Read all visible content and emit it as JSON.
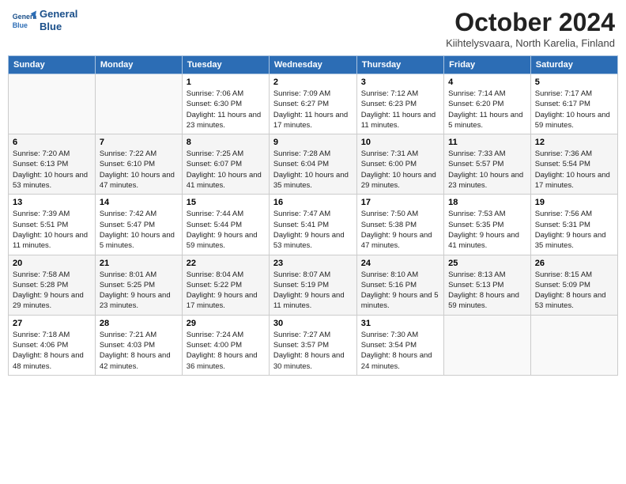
{
  "header": {
    "logo_line1": "General",
    "logo_line2": "Blue",
    "month_title": "October 2024",
    "location": "Kiihtelysvaara, North Karelia, Finland"
  },
  "days_of_week": [
    "Sunday",
    "Monday",
    "Tuesday",
    "Wednesday",
    "Thursday",
    "Friday",
    "Saturday"
  ],
  "weeks": [
    [
      {
        "day": null,
        "info": ""
      },
      {
        "day": null,
        "info": ""
      },
      {
        "day": "1",
        "info": "Sunrise: 7:06 AM\nSunset: 6:30 PM\nDaylight: 11 hours and 23 minutes."
      },
      {
        "day": "2",
        "info": "Sunrise: 7:09 AM\nSunset: 6:27 PM\nDaylight: 11 hours and 17 minutes."
      },
      {
        "day": "3",
        "info": "Sunrise: 7:12 AM\nSunset: 6:23 PM\nDaylight: 11 hours and 11 minutes."
      },
      {
        "day": "4",
        "info": "Sunrise: 7:14 AM\nSunset: 6:20 PM\nDaylight: 11 hours and 5 minutes."
      },
      {
        "day": "5",
        "info": "Sunrise: 7:17 AM\nSunset: 6:17 PM\nDaylight: 10 hours and 59 minutes."
      }
    ],
    [
      {
        "day": "6",
        "info": "Sunrise: 7:20 AM\nSunset: 6:13 PM\nDaylight: 10 hours and 53 minutes."
      },
      {
        "day": "7",
        "info": "Sunrise: 7:22 AM\nSunset: 6:10 PM\nDaylight: 10 hours and 47 minutes."
      },
      {
        "day": "8",
        "info": "Sunrise: 7:25 AM\nSunset: 6:07 PM\nDaylight: 10 hours and 41 minutes."
      },
      {
        "day": "9",
        "info": "Sunrise: 7:28 AM\nSunset: 6:04 PM\nDaylight: 10 hours and 35 minutes."
      },
      {
        "day": "10",
        "info": "Sunrise: 7:31 AM\nSunset: 6:00 PM\nDaylight: 10 hours and 29 minutes."
      },
      {
        "day": "11",
        "info": "Sunrise: 7:33 AM\nSunset: 5:57 PM\nDaylight: 10 hours and 23 minutes."
      },
      {
        "day": "12",
        "info": "Sunrise: 7:36 AM\nSunset: 5:54 PM\nDaylight: 10 hours and 17 minutes."
      }
    ],
    [
      {
        "day": "13",
        "info": "Sunrise: 7:39 AM\nSunset: 5:51 PM\nDaylight: 10 hours and 11 minutes."
      },
      {
        "day": "14",
        "info": "Sunrise: 7:42 AM\nSunset: 5:47 PM\nDaylight: 10 hours and 5 minutes."
      },
      {
        "day": "15",
        "info": "Sunrise: 7:44 AM\nSunset: 5:44 PM\nDaylight: 9 hours and 59 minutes."
      },
      {
        "day": "16",
        "info": "Sunrise: 7:47 AM\nSunset: 5:41 PM\nDaylight: 9 hours and 53 minutes."
      },
      {
        "day": "17",
        "info": "Sunrise: 7:50 AM\nSunset: 5:38 PM\nDaylight: 9 hours and 47 minutes."
      },
      {
        "day": "18",
        "info": "Sunrise: 7:53 AM\nSunset: 5:35 PM\nDaylight: 9 hours and 41 minutes."
      },
      {
        "day": "19",
        "info": "Sunrise: 7:56 AM\nSunset: 5:31 PM\nDaylight: 9 hours and 35 minutes."
      }
    ],
    [
      {
        "day": "20",
        "info": "Sunrise: 7:58 AM\nSunset: 5:28 PM\nDaylight: 9 hours and 29 minutes."
      },
      {
        "day": "21",
        "info": "Sunrise: 8:01 AM\nSunset: 5:25 PM\nDaylight: 9 hours and 23 minutes."
      },
      {
        "day": "22",
        "info": "Sunrise: 8:04 AM\nSunset: 5:22 PM\nDaylight: 9 hours and 17 minutes."
      },
      {
        "day": "23",
        "info": "Sunrise: 8:07 AM\nSunset: 5:19 PM\nDaylight: 9 hours and 11 minutes."
      },
      {
        "day": "24",
        "info": "Sunrise: 8:10 AM\nSunset: 5:16 PM\nDaylight: 9 hours and 5 minutes."
      },
      {
        "day": "25",
        "info": "Sunrise: 8:13 AM\nSunset: 5:13 PM\nDaylight: 8 hours and 59 minutes."
      },
      {
        "day": "26",
        "info": "Sunrise: 8:15 AM\nSunset: 5:09 PM\nDaylight: 8 hours and 53 minutes."
      }
    ],
    [
      {
        "day": "27",
        "info": "Sunrise: 7:18 AM\nSunset: 4:06 PM\nDaylight: 8 hours and 48 minutes."
      },
      {
        "day": "28",
        "info": "Sunrise: 7:21 AM\nSunset: 4:03 PM\nDaylight: 8 hours and 42 minutes."
      },
      {
        "day": "29",
        "info": "Sunrise: 7:24 AM\nSunset: 4:00 PM\nDaylight: 8 hours and 36 minutes."
      },
      {
        "day": "30",
        "info": "Sunrise: 7:27 AM\nSunset: 3:57 PM\nDaylight: 8 hours and 30 minutes."
      },
      {
        "day": "31",
        "info": "Sunrise: 7:30 AM\nSunset: 3:54 PM\nDaylight: 8 hours and 24 minutes."
      },
      {
        "day": null,
        "info": ""
      },
      {
        "day": null,
        "info": ""
      }
    ]
  ]
}
